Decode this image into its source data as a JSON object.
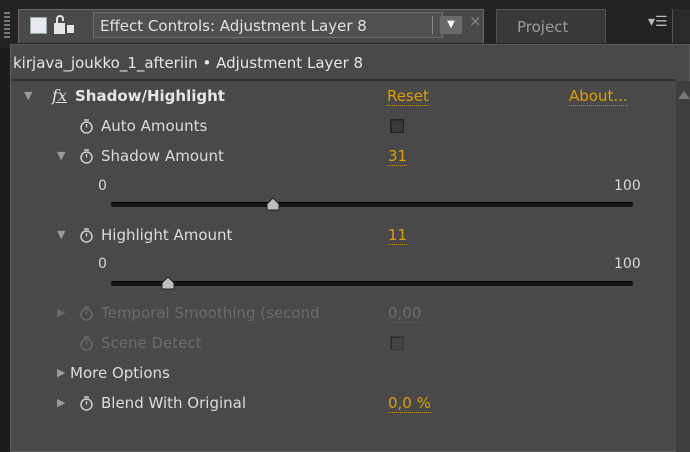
{
  "tabbar": {
    "active_tab_title": "Effect Controls: Adjustment Layer 8",
    "inactive_tab_title": "Project"
  },
  "panel": {
    "layer_path": "kirjava_joukko_1_afteriin • Adjustment Layer 8",
    "effect": {
      "fx_label": "fx",
      "name": "Shadow/Highlight",
      "reset_label": "Reset",
      "about_label": "About..."
    },
    "auto_amounts": {
      "label": "Auto Amounts",
      "checked": false
    },
    "shadow_amount": {
      "label": "Shadow Amount",
      "value": "31",
      "min_label": "0",
      "max_label": "100",
      "fraction": 0.31
    },
    "highlight_amount": {
      "label": "Highlight Amount",
      "value": "11",
      "min_label": "0",
      "max_label": "100",
      "fraction": 0.11
    },
    "temporal_smoothing": {
      "label": "Temporal Smoothing (second",
      "value": "0,00"
    },
    "scene_detect": {
      "label": "Scene Detect"
    },
    "more_options": {
      "label": "More Options"
    },
    "blend_with_original": {
      "label": "Blend With Original",
      "value": "0,0 %"
    }
  },
  "colors": {
    "panel_bg": "#494949",
    "value_orange": "#e0a000",
    "label_text": "#dcdcdc",
    "dim_text": "#6c6c6c"
  }
}
